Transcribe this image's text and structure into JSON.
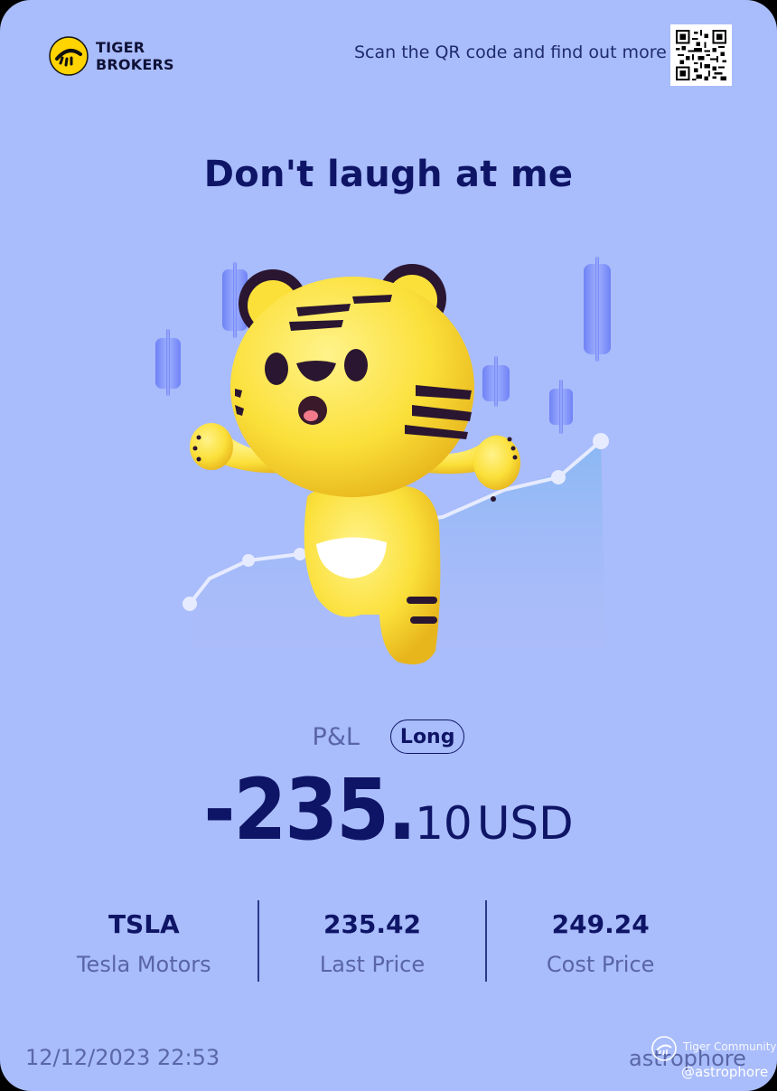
{
  "brand": {
    "name_line1": "TIGER",
    "name_line2": "BROKERS",
    "logo_icon": "tiger-stripes-logo-icon"
  },
  "header": {
    "scan_text": "Scan the QR code and find out more",
    "qr_icon": "qr-code-icon"
  },
  "headline": "Don't laugh at me",
  "illustration": {
    "icon": "tiger-mascot-icon"
  },
  "pnl": {
    "label": "P&L",
    "position_type": "Long",
    "amount_int": "-235.",
    "amount_dec": "10",
    "currency": "USD"
  },
  "stats": [
    {
      "value": "TSLA",
      "label": "Tesla Motors"
    },
    {
      "value": "235.42",
      "label": "Last Price"
    },
    {
      "value": "249.24",
      "label": "Cost Price"
    }
  ],
  "footer": {
    "date": "12/12/2023 22:53",
    "username": "astrophore",
    "watermark_title": "Tiger Community",
    "watermark_handle": "@astrophore"
  },
  "colors": {
    "background": "#a9bcfb",
    "primary_text": "#0f1566",
    "secondary_text": "#5965a8",
    "tiger_yellow": "#fbe03a"
  }
}
